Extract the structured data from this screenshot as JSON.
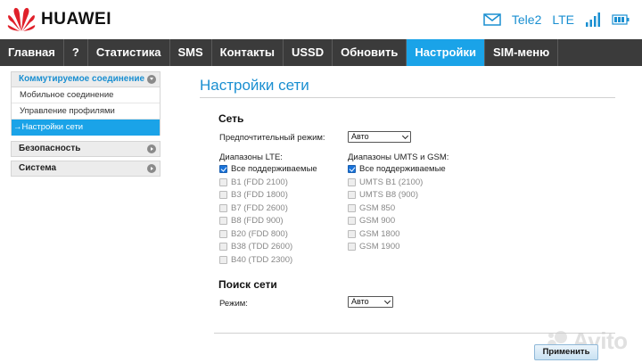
{
  "header": {
    "brand": "HUAWEI",
    "operator": "Tele2",
    "network": "LTE"
  },
  "nav": {
    "tabs": [
      {
        "label": "Главная",
        "active": false
      },
      {
        "label": "?",
        "active": false
      },
      {
        "label": "Статистика",
        "active": false
      },
      {
        "label": "SMS",
        "active": false
      },
      {
        "label": "Контакты",
        "active": false
      },
      {
        "label": "USSD",
        "active": false
      },
      {
        "label": "Обновить",
        "active": false
      },
      {
        "label": "Настройки",
        "active": true
      },
      {
        "label": "SIM-меню",
        "active": false
      }
    ]
  },
  "sidebar": {
    "dialup": {
      "label": "Коммутируемое соединение",
      "items": [
        "Мобильное соединение",
        "Управление профилями",
        "Настройки сети"
      ]
    },
    "security": "Безопасность",
    "system": "Система"
  },
  "main": {
    "title": "Настройки сети",
    "network_section": "Сеть",
    "preferred_mode_label": "Предпочтительный режим:",
    "preferred_mode_value": "Авто",
    "lte_label": "Диапазоны LTE:",
    "umts_label": "Диапазоны UMTS и GSM:",
    "lte_bands": [
      {
        "label": "Все поддерживаемые",
        "checked": true
      },
      {
        "label": "B1 (FDD 2100)",
        "checked": false
      },
      {
        "label": "B3 (FDD 1800)",
        "checked": false
      },
      {
        "label": "B7 (FDD 2600)",
        "checked": false
      },
      {
        "label": "B8 (FDD 900)",
        "checked": false
      },
      {
        "label": "B20 (FDD 800)",
        "checked": false
      },
      {
        "label": "B38 (TDD 2600)",
        "checked": false
      },
      {
        "label": "B40 (TDD 2300)",
        "checked": false
      }
    ],
    "umts_bands": [
      {
        "label": "Все поддерживаемые",
        "checked": true
      },
      {
        "label": "UMTS B1 (2100)",
        "checked": false
      },
      {
        "label": "UMTS B8 (900)",
        "checked": false
      },
      {
        "label": "GSM 850",
        "checked": false
      },
      {
        "label": "GSM 900",
        "checked": false
      },
      {
        "label": "GSM 1800",
        "checked": false
      },
      {
        "label": "GSM 1900",
        "checked": false
      }
    ],
    "search_section": "Поиск сети",
    "search_mode_label": "Режим:",
    "search_mode_value": "Авто",
    "apply_label": "Применить"
  },
  "watermark": {
    "text": "Avito"
  },
  "colors": {
    "accent": "#1aa3e8",
    "nav_bg": "#3b3b3b",
    "title": "#1a8fd1"
  }
}
